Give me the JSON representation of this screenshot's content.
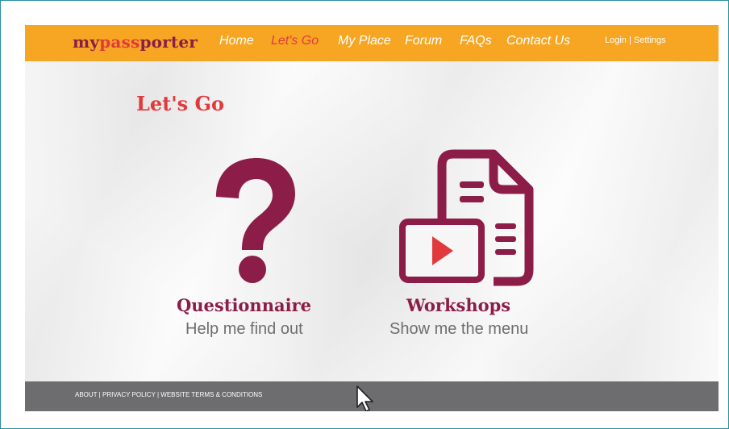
{
  "header": {
    "logo_part1": "my",
    "logo_part2": "pass",
    "logo_part3": "porter",
    "nav": [
      "Home",
      "Let's Go",
      "My Place",
      "Forum",
      "FAQs",
      "Contact Us"
    ],
    "active_nav": "Let's Go",
    "login": "Login",
    "separator": " | ",
    "settings": "Settings"
  },
  "main": {
    "heading": "Let's Go",
    "cards": [
      {
        "title": "Questionnaire",
        "subtitle": "Help me find out",
        "icon": "question-mark-icon"
      },
      {
        "title": "Workshops",
        "subtitle": "Show me the menu",
        "icon": "document-video-icon"
      }
    ]
  },
  "footer": {
    "about": "ABOUT",
    "privacy": "PRIVACY POLICY",
    "terms": "WEBSITE TERMS & CONDITIONS",
    "separator": " | "
  },
  "colors": {
    "topbar": "#f6a623",
    "brand_maroon": "#8c1c48",
    "accent_red": "#e23a3c",
    "footer": "#6d6d70"
  }
}
